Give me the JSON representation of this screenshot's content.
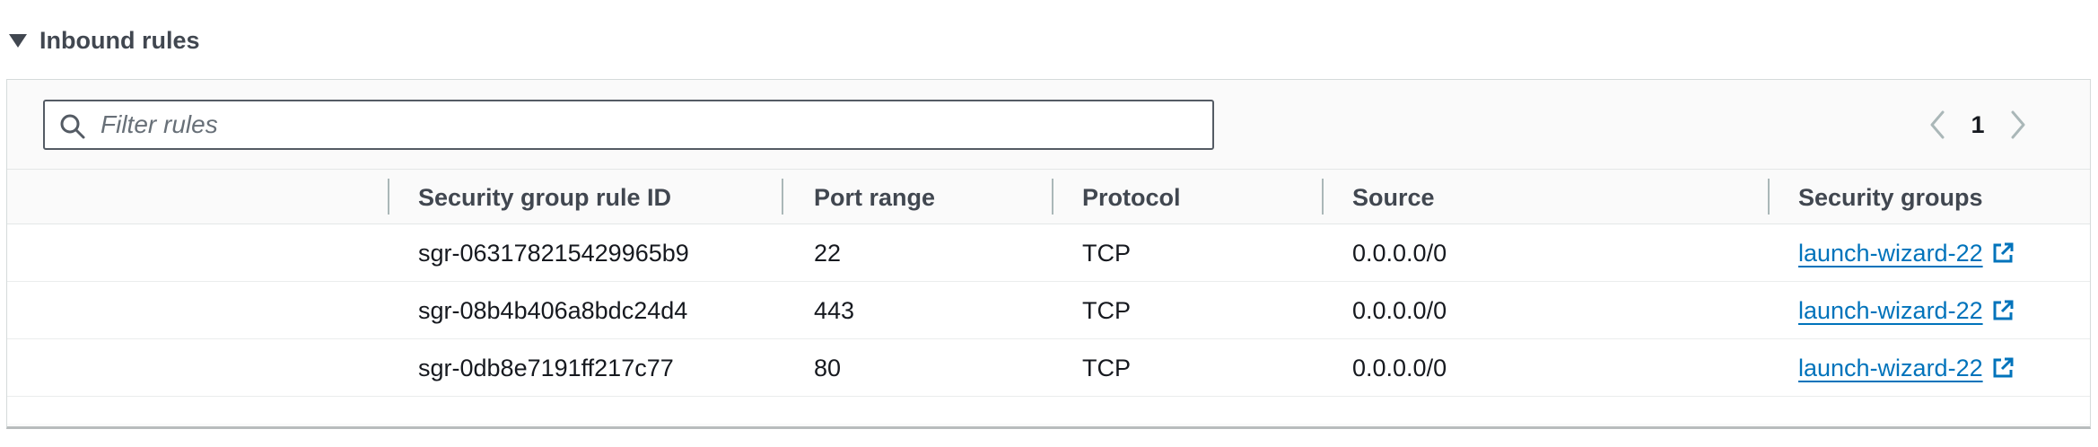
{
  "section": {
    "title": "Inbound rules"
  },
  "filter": {
    "placeholder": "Filter rules",
    "value": ""
  },
  "pagination": {
    "current_page": "1"
  },
  "table": {
    "columns": [
      "Security group rule ID",
      "Port range",
      "Protocol",
      "Source",
      "Security groups"
    ],
    "rows": [
      {
        "rule_id": "sgr-063178215429965b9",
        "port_range": "22",
        "protocol": "TCP",
        "source": "0.0.0.0/0",
        "security_group": "launch-wizard-22"
      },
      {
        "rule_id": "sgr-08b4b406a8bdc24d4",
        "port_range": "443",
        "protocol": "TCP",
        "source": "0.0.0.0/0",
        "security_group": "launch-wizard-22"
      },
      {
        "rule_id": "sgr-0db8e7191ff217c77",
        "port_range": "80",
        "protocol": "TCP",
        "source": "0.0.0.0/0",
        "security_group": "launch-wizard-22"
      }
    ]
  },
  "icons": {
    "expand": "caret-down-icon",
    "search": "search-icon",
    "prev": "chevron-left-icon",
    "next": "chevron-right-icon",
    "external": "external-link-icon"
  },
  "colors": {
    "link": "#0073bb",
    "header_text": "#414750",
    "border": "#d5dbdb"
  }
}
